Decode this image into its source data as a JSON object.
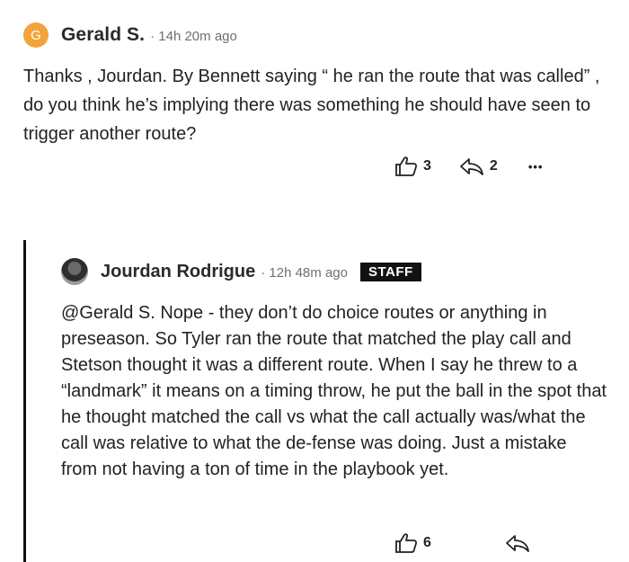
{
  "comment": {
    "avatar_letter": "G",
    "author": "Gerald S.",
    "timestamp": "· 14h 20m ago",
    "body": "Thanks , Jourdan. By Bennett saying “ he ran the route that was called” , do you think he’s implying there was something he should have seen to trigger another route?",
    "like_count": "3",
    "reply_count": "2",
    "more_label": "•••",
    "icons": {
      "like": "thumbs-up-icon",
      "reply": "reply-arrow-icon",
      "more": "more-dots-icon"
    }
  },
  "reply": {
    "author": "Jourdan Rodrigue",
    "timestamp": "· 12h 48m ago",
    "badge": "STAFF",
    "body": "@Gerald S. Nope - they don’t do choice routes or anything in preseason. So Tyler ran the route that matched the play call and Stetson thought it was a different route. When I say he threw to a “landmark” it means on a timing throw, he put the ball in the spot that he thought matched the call vs what the call actually was/what the call was relative to what the de-fense was doing. Just a mistake from not having a ton of time in the playbook yet.",
    "like_count": "6",
    "icons": {
      "like": "thumbs-up-icon",
      "reply": "reply-arrow-icon"
    }
  },
  "colors": {
    "avatar_bg": "#f2a33a",
    "badge_bg": "#121212",
    "thread_bar": "#111111"
  }
}
